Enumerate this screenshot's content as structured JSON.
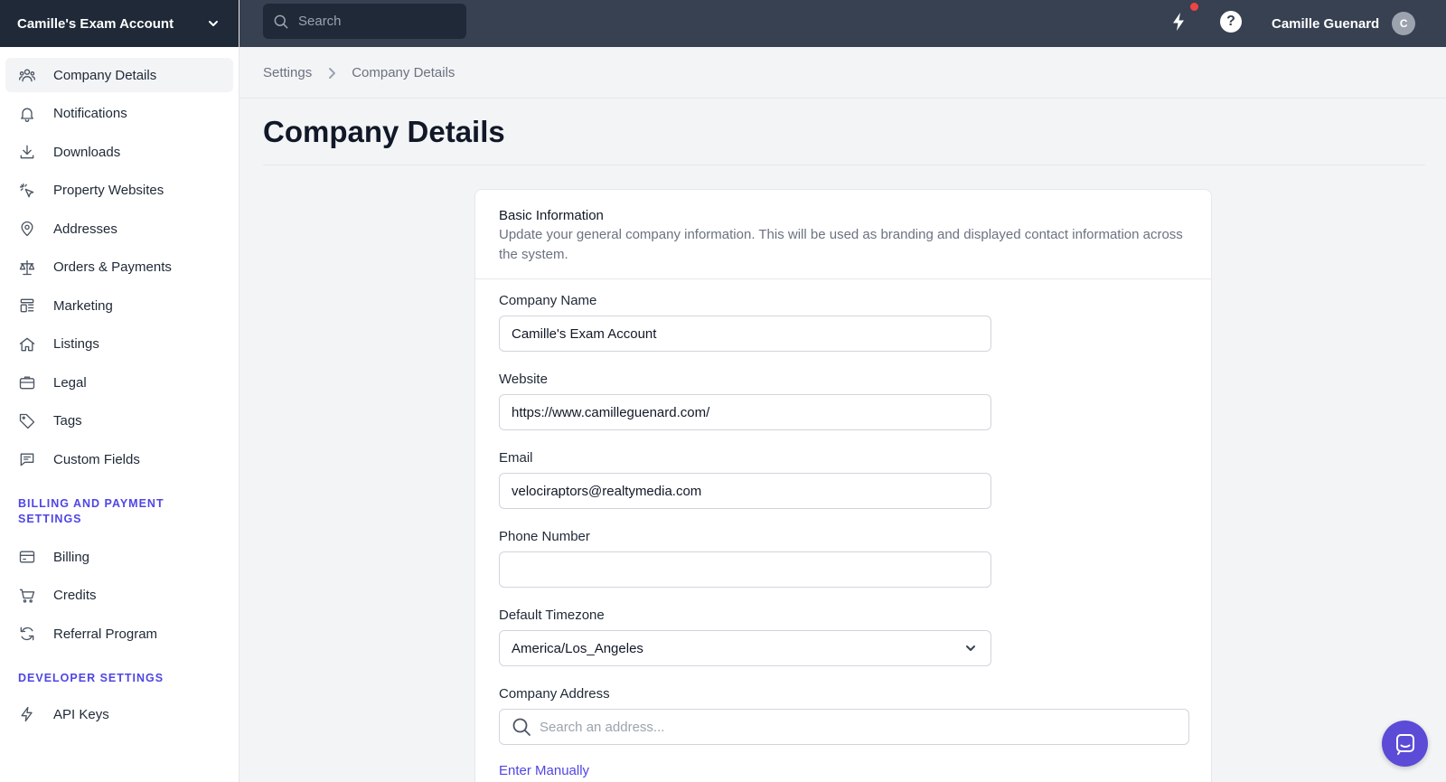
{
  "account": {
    "name": "Camille's Exam Account"
  },
  "search": {
    "placeholder": "Search"
  },
  "user": {
    "name": "Camille Guenard",
    "initial": "C"
  },
  "sidebar": {
    "items": [
      {
        "label": "Company Details",
        "icon": "users-icon"
      },
      {
        "label": "Notifications",
        "icon": "bell-icon"
      },
      {
        "label": "Downloads",
        "icon": "download-icon"
      },
      {
        "label": "Property Websites",
        "icon": "cursor-click-icon"
      },
      {
        "label": "Addresses",
        "icon": "map-pin-icon"
      },
      {
        "label": "Orders & Payments",
        "icon": "scale-icon"
      },
      {
        "label": "Marketing",
        "icon": "template-icon"
      },
      {
        "label": "Listings",
        "icon": "home-icon"
      },
      {
        "label": "Legal",
        "icon": "briefcase-icon"
      },
      {
        "label": "Tags",
        "icon": "tag-icon"
      },
      {
        "label": "Custom Fields",
        "icon": "chat-alt-icon"
      }
    ],
    "billing_title": "BILLING AND PAYMENT SETTINGS",
    "billing_items": [
      {
        "label": "Billing",
        "icon": "credit-card-icon"
      },
      {
        "label": "Credits",
        "icon": "shopping-cart-icon"
      },
      {
        "label": "Referral Program",
        "icon": "refresh-icon"
      }
    ],
    "developer_title": "DEVELOPER SETTINGS",
    "developer_items": [
      {
        "label": "API Keys",
        "icon": "lightning-icon"
      }
    ]
  },
  "breadcrumb": {
    "root": "Settings",
    "current": "Company Details"
  },
  "page": {
    "title": "Company Details"
  },
  "card": {
    "title": "Basic Information",
    "description": "Update your general company information. This will be used as branding and displayed contact information across the system."
  },
  "form": {
    "company_name": {
      "label": "Company Name",
      "value": "Camille's Exam Account"
    },
    "website": {
      "label": "Website",
      "value": "https://www.camilleguenard.com/"
    },
    "email": {
      "label": "Email",
      "value": "velociraptors@realtymedia.com"
    },
    "phone": {
      "label": "Phone Number",
      "value": ""
    },
    "timezone": {
      "label": "Default Timezone",
      "value": "America/Los_Angeles"
    },
    "address": {
      "label": "Company Address",
      "placeholder": "Search an address..."
    },
    "enter_manually": "Enter Manually"
  },
  "colors": {
    "accent": "#4f46e5",
    "topbar": "#374151",
    "account_bar": "#1f2937",
    "notification": "#ef4444",
    "chat": "#5b4bd6"
  }
}
